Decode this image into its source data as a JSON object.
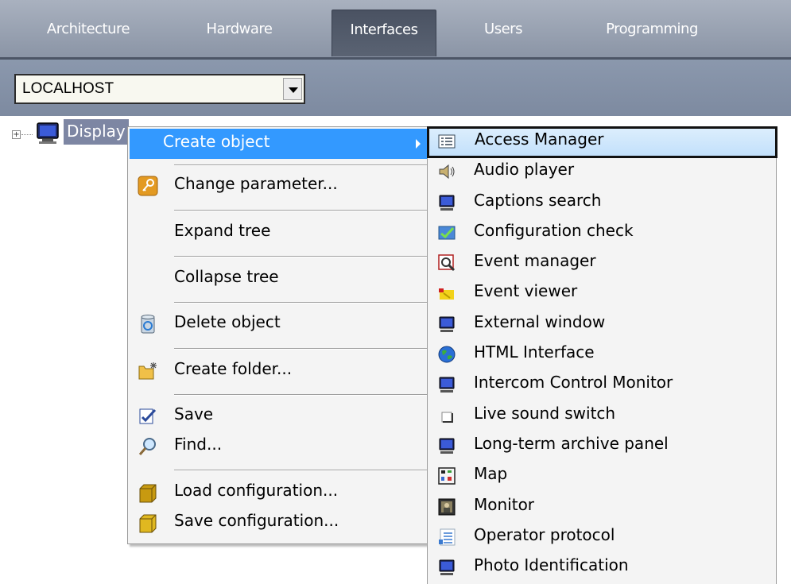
{
  "tabs": [
    {
      "label": "Architecture"
    },
    {
      "label": "Hardware"
    },
    {
      "label": "Interfaces",
      "active": true
    },
    {
      "label": "Users"
    },
    {
      "label": "Programming"
    }
  ],
  "server_select": {
    "value": "LOCALHOST"
  },
  "tree": {
    "node_label": "Display"
  },
  "context_menu": {
    "items": [
      {
        "label": "Create object",
        "icon": "none",
        "submenu": true
      },
      {
        "label": "Change parameter...",
        "icon": "key-icon"
      },
      {
        "label": "Expand tree",
        "icon": "none"
      },
      {
        "label": "Collapse tree",
        "icon": "none"
      },
      {
        "label": "Delete object",
        "icon": "recycle-bin-icon"
      },
      {
        "label": "Create folder...",
        "icon": "new-folder-icon"
      },
      {
        "label": "Save",
        "icon": "save-icon"
      },
      {
        "label": "Find...",
        "icon": "magnifier-icon"
      },
      {
        "label": "Load configuration...",
        "icon": "load-config-icon"
      },
      {
        "label": "Save configuration...",
        "icon": "save-config-icon"
      }
    ]
  },
  "submenu": {
    "items": [
      {
        "label": "Access Manager",
        "icon": "list-window-icon"
      },
      {
        "label": "Audio player",
        "icon": "speaker-icon"
      },
      {
        "label": "Captions search",
        "icon": "monitor-icon"
      },
      {
        "label": "Configuration check",
        "icon": "check-chart-icon"
      },
      {
        "label": "Event manager",
        "icon": "event-search-icon"
      },
      {
        "label": "Event viewer",
        "icon": "event-viewer-icon"
      },
      {
        "label": "External window",
        "icon": "monitor-icon"
      },
      {
        "label": "HTML Interface",
        "icon": "globe-icon"
      },
      {
        "label": "Intercom Control Monitor",
        "icon": "monitor-icon"
      },
      {
        "label": "Live sound switch",
        "icon": "white-box-icon"
      },
      {
        "label": "Long-term archive panel",
        "icon": "monitor-icon"
      },
      {
        "label": "Map",
        "icon": "map-icon"
      },
      {
        "label": "Monitor",
        "icon": "camera-view-icon"
      },
      {
        "label": "Operator protocol",
        "icon": "protocol-icon"
      },
      {
        "label": "Photo Identification",
        "icon": "monitor-icon"
      }
    ]
  },
  "colors": {
    "tab_bar": "#8b95a6",
    "active_tab": "#4a5262",
    "menu_highlight": "#3399ff",
    "tree_selection": "#7d86a3"
  }
}
